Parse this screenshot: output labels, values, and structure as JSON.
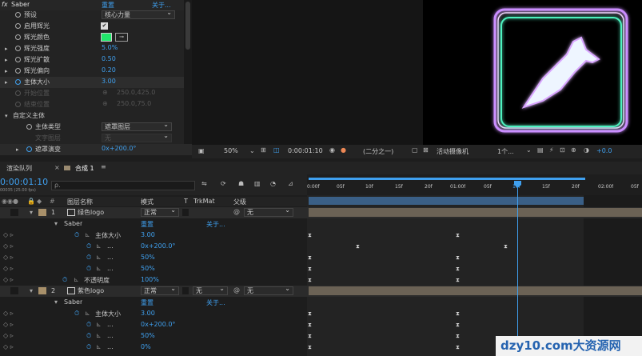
{
  "effect": {
    "header": "Saber",
    "reset": "重置",
    "about": "关于...",
    "rows": [
      {
        "label": "预设",
        "value": "核心力量"
      },
      {
        "label": "启用辉光",
        "value": "✔"
      },
      {
        "label": "辉光颜色",
        "value": ""
      },
      {
        "label": "辉光强度",
        "value": "5.0%"
      },
      {
        "label": "辉光扩散",
        "value": "0.50"
      },
      {
        "label": "辉光偏向",
        "value": "0.20"
      },
      {
        "label": "主体大小",
        "value": "3.00"
      },
      {
        "label": "开始位置",
        "value": "250.0,425.0"
      },
      {
        "label": "结束位置",
        "value": "250.0,75.0"
      },
      {
        "label": "自定义主体",
        "value": ""
      },
      {
        "label": "主体类型",
        "value": "遮罩图层"
      },
      {
        "label": "文字图层",
        "value": "无"
      },
      {
        "label": "遮罩演变",
        "value": "0x+200.0°"
      }
    ],
    "glow_color": "#21e86b"
  },
  "viewer": {
    "zoom": "50%",
    "timecode": "0:00:01:10",
    "resolution": "(二分之一)",
    "camera": "活动摄像机",
    "views": "1个...",
    "exposure": "+0.0"
  },
  "panel_tabs": {
    "render": "渲染队列",
    "comp": "合成 1"
  },
  "timecode": "0:00:01:10",
  "fps": "00035 (25.00 fps)",
  "search_placeholder": "ρ.",
  "columns": {
    "num": "#",
    "name": "图层名称",
    "mode": "模式",
    "t": "T",
    "trkmat": "TrkMat",
    "parent": "父级"
  },
  "layers": [
    {
      "num": "1",
      "name": "绿色logo",
      "mode": "正常",
      "parent": "无"
    },
    {
      "num": "2",
      "name": "紫色logo",
      "mode": "正常",
      "trk": "无",
      "parent": "无"
    }
  ],
  "sub": {
    "saber": "Saber",
    "reset": "重置",
    "about": "关于...",
    "main_size": "主体大小",
    "main_val": "3.00",
    "rot": "0x+200.0°",
    "p1": "50%",
    "p2": "50%",
    "p0": "0%",
    "opacity": "不透明度",
    "opacity_val": "100%",
    "ellipsis": "..."
  },
  "ruler": [
    "0:00f",
    "05f",
    "10f",
    "15f",
    "20f",
    "01:00f",
    "05f",
    "10f",
    "15f",
    "20f",
    "02:00f",
    "05f"
  ],
  "watermark": "dzy10.com大资源网"
}
